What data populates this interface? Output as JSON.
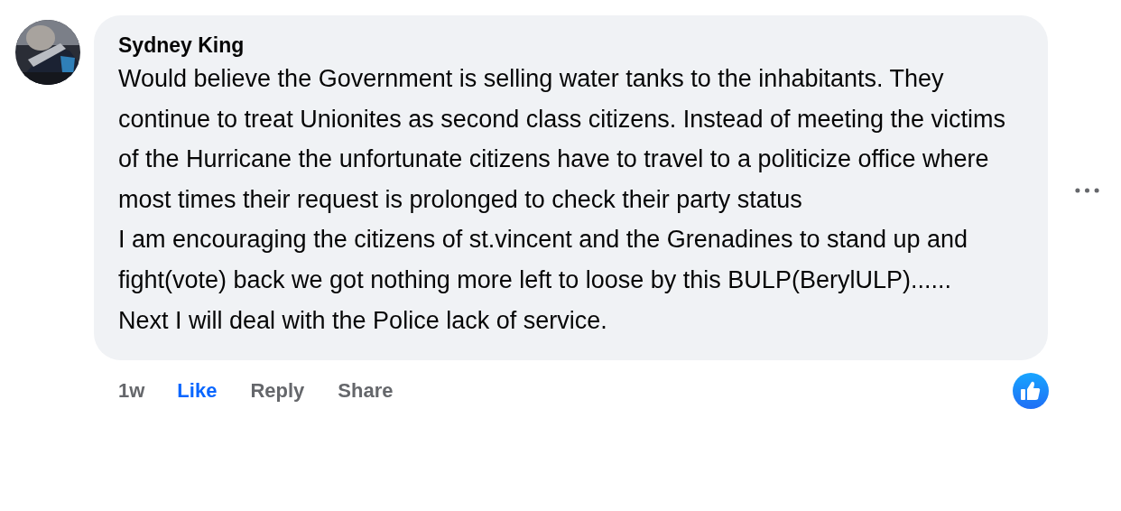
{
  "comment": {
    "author": "Sydney King",
    "text": "Would believe the Government is selling water tanks to the inhabitants. They continue to treat Unionites as second class citizens. Instead of meeting the victims of the Hurricane the unfortunate citizens have to travel to a politicize office where most times their request is prolonged to check their party status\nI am encouraging the citizens of st.vincent and the Grenadines to stand up and fight(vote) back we got nothing more left to loose by this BULP(BerylULP)......\nNext I will deal with the Police lack of service.",
    "time": "1w",
    "liked": true,
    "actions": [
      {
        "kind": "like",
        "label": "Like"
      },
      {
        "kind": "reply",
        "label": "Reply"
      },
      {
        "kind": "share",
        "label": "Share"
      }
    ],
    "reactions": [
      {
        "kind": "like"
      }
    ]
  }
}
